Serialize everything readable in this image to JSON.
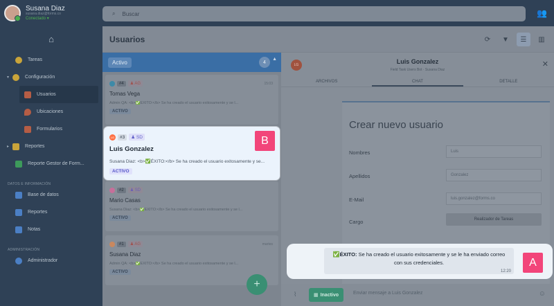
{
  "profile": {
    "name": "Susana Diaz",
    "email": "susana.diaz@forms.co",
    "status": "Conectado"
  },
  "nav": {
    "tareas": "Tareas",
    "configuracion": "Configuración",
    "usuarios": "Usuarios",
    "ubicaciones": "Ubicaciones",
    "formularios": "Formularios",
    "reportes": "Reportes",
    "reporte_gestor": "Reporte Gestor de Form...",
    "section_datos": "DATOS E INFORMACIÓN",
    "base_datos": "Base de datos",
    "reportes2": "Reportes",
    "notas": "Notas",
    "section_admin": "ADMINISTRACIÓN",
    "administrador": "Administrador"
  },
  "search": {
    "placeholder": "Buscar"
  },
  "header": {
    "title": "Usuarios"
  },
  "filter": {
    "label": "Activo",
    "count": "4"
  },
  "cards": [
    {
      "num": "#4",
      "user": "AG",
      "time": "15:03",
      "name": "Tomas Vega",
      "msg": "Admin QA: <b>✅ÉXITO:</b> Se ha creado el usuario exitosamente y se l...",
      "status": "ACTIVO"
    },
    {
      "num": "#3",
      "user": "SD",
      "avatar": "LG",
      "name": "Luis Gonzalez",
      "msg": "Susana Diaz: <b>✅ÉXITO:</b> Se ha creado el usuario exitosamente y se...",
      "status": "ACTIVO"
    },
    {
      "num": "#2",
      "user": "SD",
      "time": "",
      "name": "Mario Casas",
      "msg": "Susana Diaz: <b>✅ÉXITO:</b> Se ha creado el usuario exitosamente y se l...",
      "status": "ACTIVO"
    },
    {
      "num": "#1",
      "user": "AG",
      "time": "martes",
      "name": "Susana Diaz",
      "msg": "Admin QA: <b>✅ÉXITO:</b> Se ha creado el usuario exitosamente y se l...",
      "status": "ACTIVO"
    }
  ],
  "detail": {
    "avatar": "LG",
    "name": "Luis Gonzalez",
    "subtitle": "Field Task Users Bot · Susana Diaz",
    "tabs": [
      "ARCHIVOS",
      "CHAT",
      "DETALLE"
    ]
  },
  "form": {
    "title": "Crear nuevo usuario",
    "nombres_label": "Nombres",
    "nombres_value": "Luis",
    "apellidos_label": "Apellidos",
    "apellidos_value": "Gonzalez",
    "email_label": "E-Mail",
    "email_value": "luis.gonzalez@forms.co",
    "cargo_label": "Cargo",
    "cargo_value": "Realizador de Tareas"
  },
  "chatbar": {
    "inactive": "Inactivo",
    "placeholder": "Enviar mensaje a Luis Gonzalez"
  },
  "toast": {
    "bold": "ÉXITO:",
    "text": "Se ha creado el usuario exitosamente y se le ha enviado correo con sus credenciales.",
    "time": "12:20"
  },
  "markers": {
    "a": "A",
    "b": "B"
  }
}
